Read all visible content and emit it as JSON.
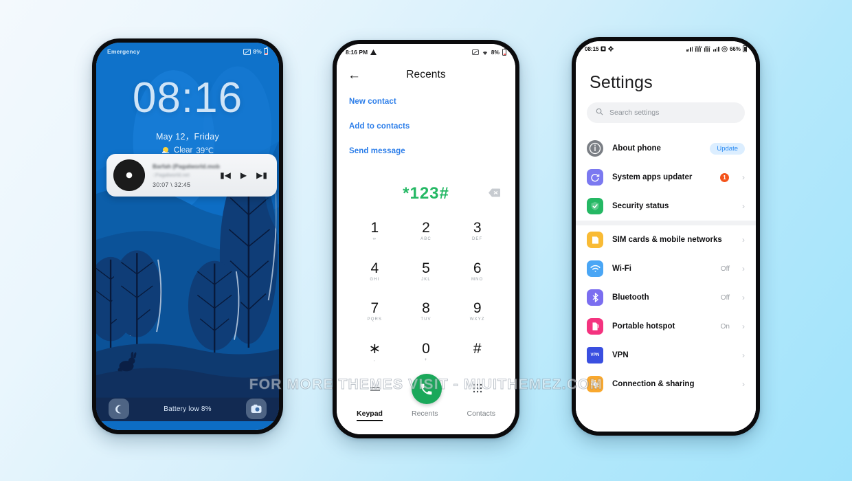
{
  "background": {
    "from": "#f4f9fd",
    "to": "#a0e3fb"
  },
  "watermark": {
    "text": "FOR MORE THEMES VISIT - MIUITHEMEZ.COM"
  },
  "lockscreen": {
    "status": {
      "left_label": "Emergency",
      "battery_percent": "8%",
      "camera_icon": "camera-blocked-icon"
    },
    "clock": "08:16",
    "date": "May 12，Friday",
    "weather": {
      "icon": "sun-icon",
      "condition": "Clear",
      "temperature": "39℃"
    },
    "music": {
      "album_icon": "vinyl-disc-icon",
      "title": "Barfah (Pagalworld.mobi)",
      "subtitle": "::Pagalworld.net",
      "elapsed_total": "30:07 \\ 32:45",
      "prev_icon": "skip-previous-icon",
      "play_icon": "play-icon",
      "next_icon": "skip-next-icon"
    },
    "bottom": {
      "left_icon": "phone-icon",
      "message": "Battery low 8%",
      "right_icon": "camera-icon"
    },
    "colors": {
      "sky": "#0d6dc4",
      "ground": "#143a6e",
      "accent_text": "#cfe4f7"
    }
  },
  "dialer": {
    "status": {
      "time": "8:16 PM",
      "warning_icon": "warning-icon",
      "camera_icon": "camera-blocked-icon",
      "wifi_icon": "wifi-icon",
      "battery_percent": "8%"
    },
    "header": {
      "back_icon": "back-arrow-icon",
      "title": "Recents"
    },
    "links": [
      "New contact",
      "Add to contacts",
      "Send message"
    ],
    "number": "*123#",
    "backspace_icon": "backspace-icon",
    "keys": [
      {
        "digit": "1",
        "sub": "∞"
      },
      {
        "digit": "2",
        "sub": "ABC"
      },
      {
        "digit": "3",
        "sub": "DEF"
      },
      {
        "digit": "4",
        "sub": "GHI"
      },
      {
        "digit": "5",
        "sub": "JKL"
      },
      {
        "digit": "6",
        "sub": "MNO"
      },
      {
        "digit": "7",
        "sub": "PQRS"
      },
      {
        "digit": "8",
        "sub": "TUV"
      },
      {
        "digit": "9",
        "sub": "WXYZ"
      },
      {
        "digit": "∗",
        "sub": ","
      },
      {
        "digit": "0",
        "sub": "+"
      },
      {
        "digit": "#",
        "sub": ""
      }
    ],
    "actions": {
      "menu_icon": "menu-icon",
      "call_icon": "call-icon",
      "dialpad_icon": "dialpad-icon"
    },
    "tabs": [
      {
        "label": "Keypad",
        "active": true
      },
      {
        "label": "Recents",
        "active": false
      },
      {
        "label": "Contacts",
        "active": false
      }
    ],
    "colors": {
      "link": "#2b7de9",
      "number": "#24b864",
      "call_fab": "#1aa85a"
    }
  },
  "settings": {
    "status": {
      "time": "08:15",
      "sim_icon": "sim-icon",
      "gear_icon": "gear-icon",
      "signal_icon": "signal-icon",
      "volte_icon": "volte-icon",
      "data_icon": "data-signal-icon",
      "at_icon": "at-circle-icon",
      "battery_percent": "66%"
    },
    "title": "Settings",
    "search": {
      "icon": "search-icon",
      "placeholder": "Search settings"
    },
    "groups": [
      {
        "rows": [
          {
            "icon": "info-icon",
            "icon_color": "#7b7f85",
            "label": "About phone",
            "value": "",
            "pill": "Update",
            "badge": "",
            "chevron": false
          },
          {
            "icon": "system-update-icon",
            "icon_color": "#7b79f0",
            "label": "System apps updater",
            "value": "",
            "pill": "",
            "badge": "1",
            "chevron": true
          },
          {
            "icon": "shield-check-icon",
            "icon_color": "#25b864",
            "label": "Security status",
            "value": "",
            "pill": "",
            "badge": "",
            "chevron": true
          }
        ]
      },
      {
        "rows": [
          {
            "icon": "sim-card-icon",
            "icon_color": "#f9bb35",
            "label": "SIM cards & mobile networks",
            "value": "",
            "pill": "",
            "badge": "",
            "chevron": true
          },
          {
            "icon": "wifi-icon",
            "icon_color": "#4aa6f5",
            "label": "Wi-Fi",
            "value": "Off",
            "pill": "",
            "badge": "",
            "chevron": true
          },
          {
            "icon": "bluetooth-icon",
            "icon_color": "#7b6ef0",
            "label": "Bluetooth",
            "value": "Off",
            "pill": "",
            "badge": "",
            "chevron": true
          },
          {
            "icon": "hotspot-icon",
            "icon_color": "#f4337f",
            "label": "Portable hotspot",
            "value": "On",
            "pill": "",
            "badge": "",
            "chevron": true
          },
          {
            "icon": "vpn-icon",
            "icon_color": "#3a4fe0",
            "label": "VPN",
            "value": "",
            "pill": "",
            "badge": "",
            "chevron": true
          },
          {
            "icon": "connection-sharing-icon",
            "icon_color": "#f9a82e",
            "label": "Connection & sharing",
            "value": "",
            "pill": "",
            "badge": "",
            "chevron": true
          }
        ]
      }
    ],
    "colors": {
      "pill_bg": "#dceeff",
      "pill_text": "#2b8bf2",
      "badge": "#f4541c"
    }
  }
}
